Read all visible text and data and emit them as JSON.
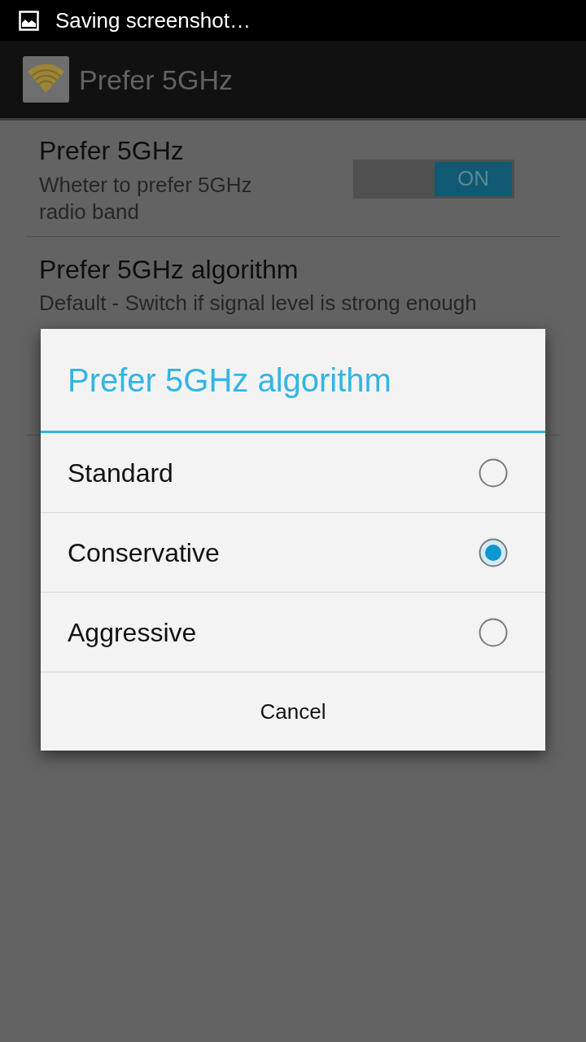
{
  "status_bar": {
    "notification": "Saving screenshot…"
  },
  "action_bar": {
    "title": "Prefer 5GHz"
  },
  "preferences": [
    {
      "kind": "switch",
      "title": "Prefer 5GHz",
      "summary": "Wheter to prefer 5GHz radio band",
      "on": true,
      "switch_label": "ON"
    },
    {
      "kind": "list",
      "title": "Prefer 5GHz algorithm",
      "summary_lines": [
        "Default - Switch if signal level is strong enough"
      ]
    }
  ],
  "dialog": {
    "title": "Prefer 5GHz algorithm",
    "options": [
      {
        "label": "Standard",
        "selected": false
      },
      {
        "label": "Conservative",
        "selected": true
      },
      {
        "label": "Aggressive",
        "selected": false
      }
    ],
    "button": "Cancel"
  }
}
